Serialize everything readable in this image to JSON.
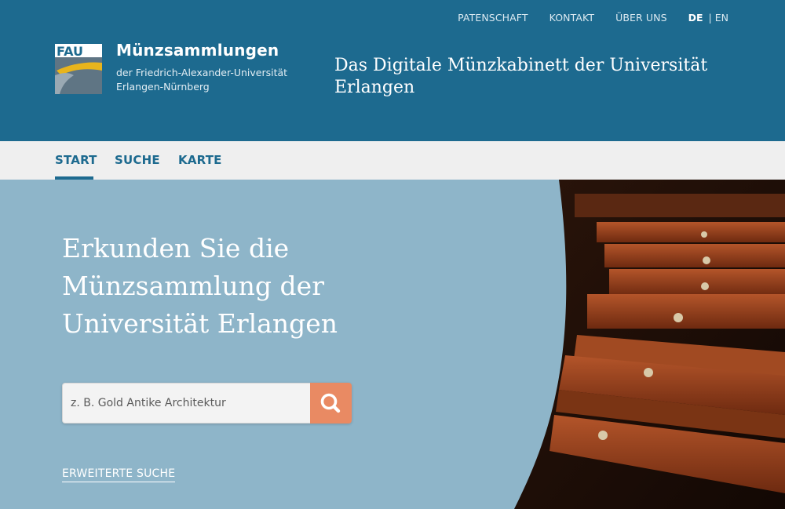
{
  "topnav": {
    "links": [
      "PATENSCHAFT",
      "KONTAKT",
      "ÜBER UNS"
    ],
    "lang_active": "DE",
    "lang_sep": "|",
    "lang_other": "EN"
  },
  "brand": {
    "logo_text": "FAU",
    "title": "Münzsammlungen",
    "subtitle_line1": "der Friedrich-Alexander-Universität",
    "subtitle_line2": "Erlangen-Nürnberg"
  },
  "tagline": "Das Digitale Münzkabinett der Universität Erlangen",
  "mainnav": {
    "items": [
      "START",
      "SUCHE",
      "KARTE"
    ],
    "active": "START"
  },
  "hero": {
    "heading_line1": "Erkunden Sie die",
    "heading_line2": "Münzsammlung der",
    "heading_line3": "Universität Erlangen",
    "search_placeholder": "z. B. Gold Antike Architektur",
    "search_icon": "search-icon",
    "advanced_search": "ERWEITERTE SUCHE"
  },
  "colors": {
    "header_bg": "#1d6a8f",
    "nav_bg": "#efefef",
    "hero_bg": "#8eb5c9",
    "accent": "#e98a63"
  }
}
